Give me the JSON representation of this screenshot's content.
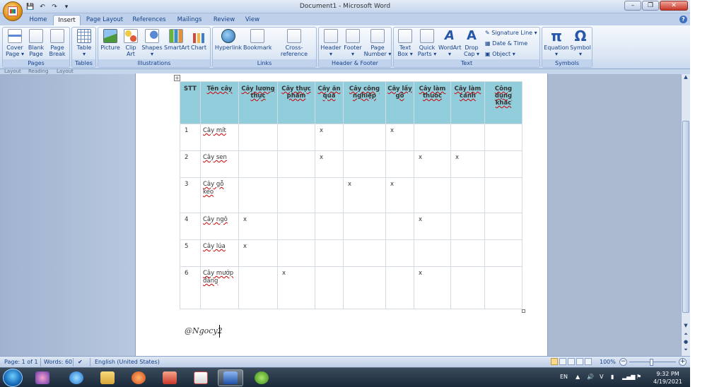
{
  "window": {
    "title": "Document1 - Microsoft Word",
    "controls": {
      "minimize": "–",
      "restore": "❐",
      "close": "✕"
    },
    "help": "?"
  },
  "qat": {
    "save": "💾",
    "undo": "↶",
    "redo": "↷",
    "more": "▾"
  },
  "tabs": [
    {
      "label": "Home"
    },
    {
      "label": "Insert",
      "active": true
    },
    {
      "label": "Page Layout"
    },
    {
      "label": "References"
    },
    {
      "label": "Mailings"
    },
    {
      "label": "Review"
    },
    {
      "label": "View"
    }
  ],
  "ribbon": {
    "groups": {
      "pages": "Pages",
      "tables": "Tables",
      "illustrations": "Illustrations",
      "links": "Links",
      "header_footer": "Header & Footer",
      "text": "Text",
      "symbols": "Symbols"
    },
    "buttons": {
      "cover_page": [
        "Cover",
        "Page ▾"
      ],
      "blank_page": [
        "Blank",
        "Page"
      ],
      "page_break": [
        "Page",
        "Break"
      ],
      "table": [
        "Table",
        "▾"
      ],
      "picture": [
        "Picture",
        ""
      ],
      "clip_art": [
        "Clip",
        "Art"
      ],
      "shapes": [
        "Shapes",
        "▾"
      ],
      "smartart": [
        "SmartArt",
        ""
      ],
      "chart": [
        "Chart",
        ""
      ],
      "hyperlink": [
        "Hyperlink",
        ""
      ],
      "bookmark": [
        "Bookmark",
        ""
      ],
      "cross_reference": [
        "Cross-reference",
        ""
      ],
      "header": [
        "Header",
        "▾"
      ],
      "footer": [
        "Footer",
        "▾"
      ],
      "page_number": [
        "Page",
        "Number ▾"
      ],
      "text_box": [
        "Text",
        "Box ▾"
      ],
      "quick_parts": [
        "Quick",
        "Parts ▾"
      ],
      "wordart": [
        "WordArt",
        "▾"
      ],
      "drop_cap": [
        "Drop",
        "Cap ▾"
      ],
      "equation": [
        "Equation",
        "▾"
      ],
      "symbol": [
        "Symbol",
        "▾"
      ]
    },
    "small": {
      "signature_line": "Signature Line ▾",
      "date_time": "Date & Time",
      "object": "Object ▾"
    },
    "symbol_glyphs": {
      "pi": "π",
      "omega": "Ω"
    }
  },
  "under_ribbon_fragments": [
    "Layout",
    "Reading",
    "Layout"
  ],
  "table": {
    "headers": [
      "STT",
      "Tên cây",
      "Cây lương thực",
      "Cây thực phẩm",
      "Cây ăn quả",
      "Cây công nghiệp",
      "Cây lấy gỗ",
      "Cây làm thuốc",
      "Cây làm cảnh",
      "Công dụng khác"
    ],
    "rows": [
      [
        "1",
        "Cây mít",
        "",
        "",
        "x",
        "",
        "x",
        "",
        "",
        ""
      ],
      [
        "2",
        "Cây sen",
        "",
        "",
        "x",
        "",
        "",
        "x",
        "x",
        ""
      ],
      [
        "3",
        "Cây gỗ keo",
        "",
        "",
        "",
        "x",
        "x",
        "",
        "",
        ""
      ],
      [
        "4",
        "Cây ngô",
        "x",
        "",
        "",
        "",
        "",
        "x",
        "",
        ""
      ],
      [
        "5",
        "Cây lúa",
        "x",
        "",
        "",
        "",
        "",
        "",
        "",
        ""
      ],
      [
        "6",
        "Cây mướp đắng",
        "",
        "x",
        "",
        "",
        "",
        "x",
        "",
        ""
      ]
    ]
  },
  "signature": "@Ngocy2",
  "status": {
    "page": "Page: 1 of 1",
    "words": "Words: 60",
    "language": "English (United States)",
    "zoom": "100%"
  },
  "taskbar": {
    "tray_lang": "EN",
    "time": "9:32 PM",
    "date": "4/19/2021"
  },
  "colors": {
    "header_fill": "#92cddc",
    "ribbon_text": "#15428b"
  }
}
